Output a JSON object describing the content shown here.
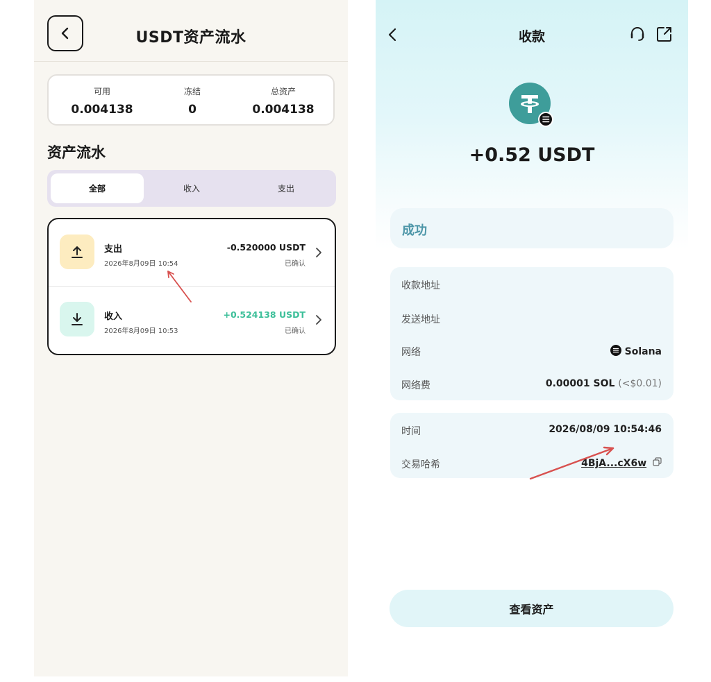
{
  "left": {
    "title": "USDT资产流水",
    "balance": {
      "available_label": "可用",
      "available_value": "0.004138",
      "frozen_label": "冻结",
      "frozen_value": "0",
      "total_label": "总资产",
      "total_value": "0.004138"
    },
    "section_heading": "资产流水",
    "tabs": [
      {
        "label": "全部",
        "active": true
      },
      {
        "label": "收入",
        "active": false
      },
      {
        "label": "支出",
        "active": false
      }
    ],
    "transactions": [
      {
        "type": "支出",
        "date": "2026年8月09日 10:54",
        "amount": "-0.520000 USDT",
        "status": "已确认",
        "icon": "upload-arrow-icon",
        "icon_bg": "#fdecc0",
        "amount_color": "#1a1a1a"
      },
      {
        "type": "收入",
        "date": "2026年8月09日 10:53",
        "amount": "+0.524138 USDT",
        "status": "已确认",
        "icon": "download-arrow-icon",
        "icon_bg": "#d9f6ee",
        "amount_color": "#3cbf99"
      }
    ]
  },
  "right": {
    "title": "收款",
    "amount": "+0.52 USDT",
    "status": "成功",
    "details": [
      {
        "label": "收款地址",
        "value": "",
        "blurred": true
      },
      {
        "label": "发送地址",
        "value": "",
        "blurred": true
      },
      {
        "label": "网络",
        "value": "Solana"
      },
      {
        "label": "网络费",
        "value": "0.00001 SOL",
        "sub": "(<$0.01)"
      }
    ],
    "time_label": "时间",
    "time_value": "2026/08/09 10:54:46",
    "hash_label": "交易哈希",
    "hash_value": "4BjA...cX6w",
    "button_label": "查看资产"
  },
  "colors": {
    "accent_teal": "#4d96a8",
    "income_green": "#3cbf99",
    "tether_teal": "#3e9d9a",
    "annotation_red": "#d8514f"
  }
}
